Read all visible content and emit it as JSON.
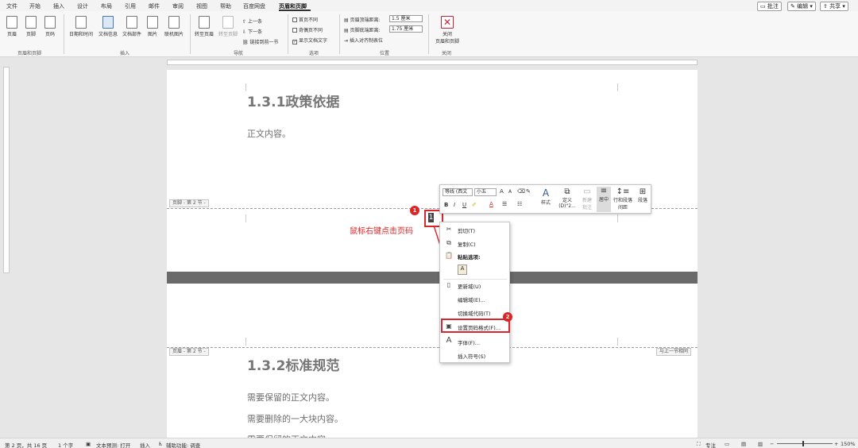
{
  "menubar": {
    "tabs": [
      "文件",
      "开始",
      "插入",
      "设计",
      "布局",
      "引用",
      "邮件",
      "审阅",
      "视图",
      "帮助",
      "百度网盘",
      "页眉和页脚"
    ],
    "active_tab": "页眉和页脚",
    "comment_label": "批注",
    "edit_label": "编辑",
    "share_label": "共享"
  },
  "ribbon": {
    "header_label": "页眉",
    "footer_label": "页脚",
    "page_number_label": "页码",
    "datetime_label": "日期和时间",
    "doc_info_label": "文档信息",
    "doc_parts_label": "文档部件",
    "picture_label": "图片",
    "online_picture_label": "联机图片",
    "goto_header_label": "转至页眉",
    "goto_footer_label": "转至页脚",
    "prev_label": "上一条",
    "next_label": "下一条",
    "link_prev_label": "链接到前一节",
    "first_page_diff_label": "首页不同",
    "odd_even_diff_label": "奇偶页不同",
    "show_doc_text_label": "显示文档文字",
    "header_top_label": "页眉顶端距离:",
    "header_top_value": "1.5 厘米",
    "footer_bottom_label": "页脚底端距离:",
    "footer_bottom_value": "1.75 厘米",
    "insert_tab_label": "插入对齐制表位",
    "close_label_1": "关闭",
    "close_label_2": "页眉和页脚",
    "groups": {
      "hf": "页眉和页脚",
      "insert": "插入",
      "nav": "导航",
      "options": "选项",
      "position": "位置",
      "close": "关闭"
    }
  },
  "page1": {
    "heading": "1.3.1政策依据",
    "body": "正文内容。",
    "footer_tag": "页脚 - 第 2 节 -"
  },
  "page2": {
    "header_tag": "页眉 - 第 2 节 -",
    "same_as_prev": "与上一节相同",
    "heading": "1.3.2标准规范",
    "lines": [
      "需要保留的正文内容。",
      "需要删除的一大块内容。",
      "需要保留的正文内容。"
    ]
  },
  "annotation": {
    "text": "鼠标右键点击页码",
    "badge1": "1",
    "badge2": "2"
  },
  "page_number_field": "1",
  "minitoolbar": {
    "font": "等线 (西文",
    "size": "小五",
    "grow": "A",
    "shrink": "A",
    "bold": "B",
    "italic": "I",
    "underline": "U",
    "styles_label": "样式",
    "define_label_1": "定义",
    "define_label_2": "(D)\"2...",
    "new_comment_label_1": "新建",
    "new_comment_label_2": "批注",
    "center_label": "居中",
    "line_spacing_label_1": "行和段落",
    "line_spacing_label_2": "间距",
    "paragraph_label": "段落"
  },
  "context_menu": {
    "cut": "剪切(T)",
    "copy": "复制(C)",
    "paste_options": "粘贴选项:",
    "update_field": "更新域(U)",
    "edit_field": "编辑域(E)...",
    "toggle_codes": "切换域代码(T)",
    "format_page_numbers": "设置页码格式(F)...",
    "font": "字体(F)...",
    "insert_symbol": "插入符号(S)"
  },
  "statusbar": {
    "page": "第 2 页，共 16 页",
    "words": "1 个字",
    "prediction": "文本预测: 打开",
    "insert_mode": "插入",
    "accessibility": "辅助功能: 调查",
    "focus": "专注",
    "zoom": "150%"
  },
  "colors": {
    "annotation_red": "#d8272d",
    "heading_gray": "#767676"
  }
}
